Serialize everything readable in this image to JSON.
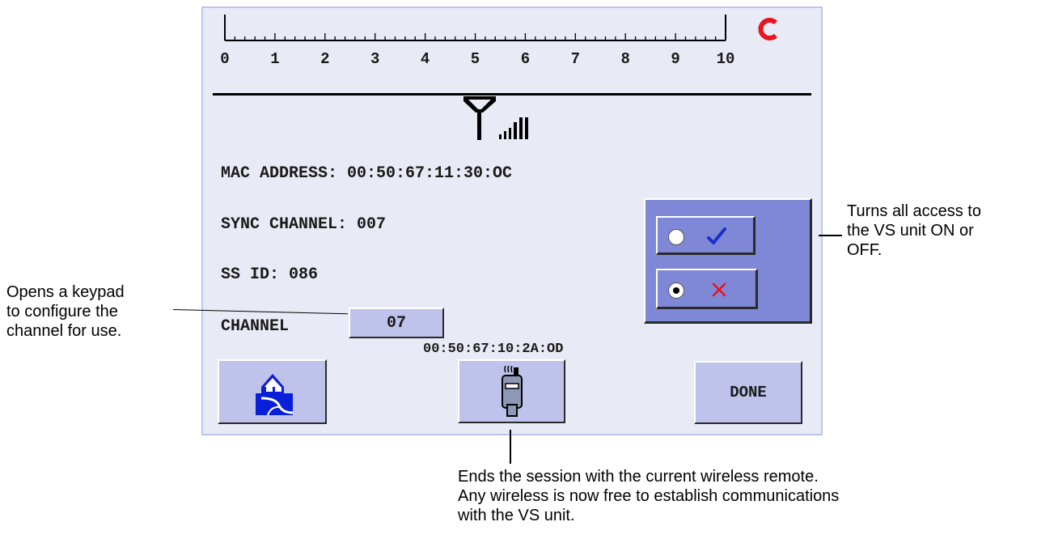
{
  "scale": {
    "ticks": [
      "0",
      "1",
      "2",
      "3",
      "4",
      "5",
      "6",
      "7",
      "8",
      "9",
      "10"
    ],
    "refresh_icon": "refresh-icon"
  },
  "signal": {
    "icon": "antenna-signal-icon"
  },
  "info": {
    "mac_address": "MAC ADDRESS: 00:50:67:11:30:OC",
    "sync_channel": "SYNC CHANNEL: 007",
    "ss_id": "SS ID: 086",
    "channel_label": "CHANNEL",
    "channel_value": "07",
    "remote_mac": "00:50:67:10:2A:OD"
  },
  "onoff": {
    "on_icon": "checkmark-icon",
    "off_icon": "x-icon",
    "selected": "off",
    "colors": {
      "on": "#1a2fcc",
      "off": "#e8141e"
    }
  },
  "buttons": {
    "home_icon": "home-icon",
    "remote_icon": "wireless-remote-icon",
    "done_label": "DONE"
  },
  "callouts": {
    "right": "Turns all access to the VS unit ON or OFF.",
    "right_lines": [
      "Turns all access to",
      "the VS unit ON or",
      "OFF."
    ],
    "left_lines": [
      "Opens a keypad",
      "to configure the",
      "channel for use."
    ],
    "bottom_lines": [
      "Ends the session with the current wireless remote.",
      "Any wireless is now free to establish communications",
      "with the VS unit."
    ]
  }
}
